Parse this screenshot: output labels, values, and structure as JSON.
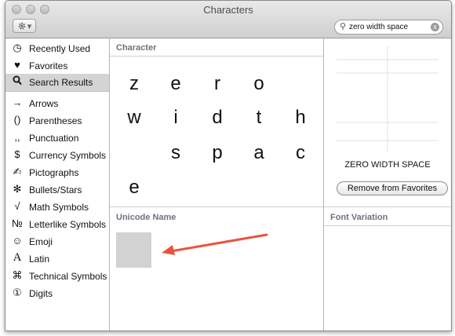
{
  "window": {
    "title": "Characters"
  },
  "toolbar": {
    "gear_icon": "gear-icon",
    "gear_menu": "▾"
  },
  "search": {
    "value": "zero width space",
    "icon": "search-icon",
    "clear_icon": "x"
  },
  "sidebar": {
    "items": [
      {
        "label": "Recently Used",
        "icon": "◷"
      },
      {
        "label": "Favorites",
        "icon": "♥"
      },
      {
        "label": "Search Results",
        "icon": "🔍",
        "selected": true
      },
      {
        "label": "Arrows",
        "icon": "→"
      },
      {
        "label": "Parentheses",
        "icon": "()"
      },
      {
        "label": "Punctuation",
        "icon": ",,"
      },
      {
        "label": "Currency Symbols",
        "icon": "$"
      },
      {
        "label": "Pictographs",
        "icon": "✍"
      },
      {
        "label": "Bullets/Stars",
        "icon": "✻"
      },
      {
        "label": "Math Symbols",
        "icon": "√"
      },
      {
        "label": "Letterlike Symbols",
        "icon": "№"
      },
      {
        "label": "Emoji",
        "icon": "☺"
      },
      {
        "label": "Latin",
        "icon": "A"
      },
      {
        "label": "Technical Symbols",
        "icon": "⌘"
      },
      {
        "label": "Digits",
        "icon": "①"
      }
    ]
  },
  "character_panel": {
    "header": "Character",
    "characters": [
      "z",
      "e",
      "r",
      "o",
      "w",
      "i",
      "d",
      "t",
      "h",
      "s",
      "p",
      "a",
      "c",
      "e"
    ]
  },
  "unicode_panel": {
    "header": "Unicode Name"
  },
  "info_panel": {
    "unicode_name": "ZERO WIDTH SPACE",
    "favorites_button": "Remove from Favorites",
    "font_variation_header": "Font Variation"
  },
  "colors": {
    "selected_bg": "#d4d4d4",
    "arrow": "#e8553f",
    "header_text": "#6b7380"
  }
}
